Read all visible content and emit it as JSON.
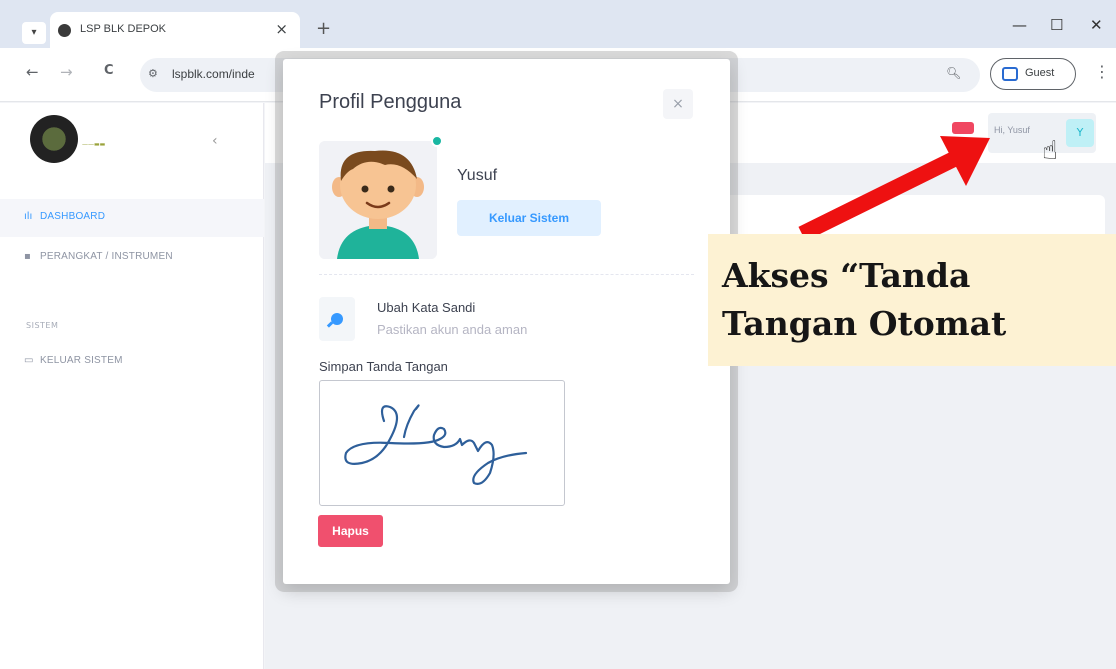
{
  "browser": {
    "tab_title": "LSP BLK DEPOK",
    "tab_close": "×",
    "new_tab": "+",
    "url": "lspblk.com/inde",
    "guest_label": "Guest",
    "controls": {
      "minimize": "—",
      "maximize": "☐",
      "close": "✕"
    },
    "nav": {
      "back": "←",
      "forward": "→",
      "reload": "C"
    }
  },
  "sidebar": {
    "items": [
      {
        "label": "DASHBOARD",
        "icon": "chart-icon"
      },
      {
        "label": "PERANGKAT / INSTRUMEN",
        "icon": "device-icon"
      }
    ],
    "section_label": "SISTEM",
    "system_items": [
      {
        "label": "KELUAR SISTEM",
        "icon": "exit-icon"
      }
    ]
  },
  "header": {
    "greeting": "Hi, Yusuf",
    "avatar_initial": "Y",
    "notification_color": "#f04761"
  },
  "modal": {
    "title": "Profil Pengguna",
    "close": "×",
    "user_name": "Yusuf",
    "logout_button": "Keluar Sistem",
    "change_password_title": "Ubah Kata Sandi",
    "change_password_subtitle": "Pastikan akun anda aman",
    "signature_label": "Simpan Tanda Tangan",
    "delete_button": "Hapus",
    "accent_color": "#3699ff",
    "danger_color": "#f0506e"
  },
  "annotation": {
    "line1": "Akses “Tanda",
    "line2": "Tangan Otomat",
    "arrow_color": "#ee1111"
  }
}
